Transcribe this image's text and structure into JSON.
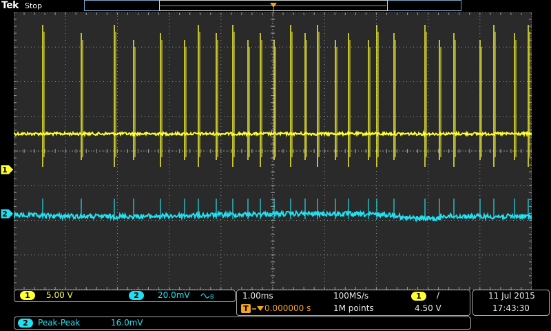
{
  "header": {
    "brand": "Tek",
    "acq_state": "Stop"
  },
  "trigger_marker": "T",
  "channels": [
    {
      "id": "1",
      "color": "#ffff33",
      "scale": "5.00 V"
    },
    {
      "id": "2",
      "color": "#22e0f0",
      "scale": "20.0mV",
      "bw_limit_icon": "bandwidth-limit-icon"
    }
  ],
  "horizontal": {
    "time_per_div": "1.00ms",
    "delay_prefix": "T",
    "delay": "0.000000 s",
    "sample_rate": "100MS/s",
    "record_length": "1M points"
  },
  "trigger": {
    "source": "1",
    "slope": "/",
    "level": "4.50 V"
  },
  "datetime": {
    "date": "11 Jul  2015",
    "time": "17:43:30"
  },
  "measurement": {
    "source": "2",
    "name": "Peak-Peak",
    "value": "16.0mV"
  },
  "colors": {
    "ch1": "#ffff33",
    "ch2": "#22e0f0",
    "grid": "#9a9a9a",
    "trigger": "#f2a31f",
    "screen_bg": "#2a2a2a"
  }
}
